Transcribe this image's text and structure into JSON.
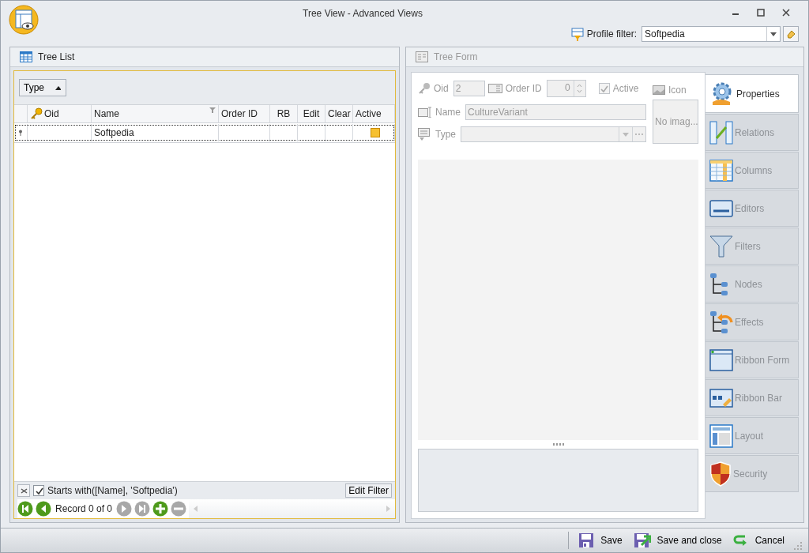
{
  "window": {
    "title": "Tree View - Advanced Views"
  },
  "profile_filter": {
    "label": "Profile filter:",
    "value": "Softpedia"
  },
  "tree_list": {
    "title": "Tree List",
    "group_button": "Type",
    "columns": [
      {
        "label": "Oid"
      },
      {
        "label": "Name"
      },
      {
        "label": "Order ID"
      },
      {
        "label": "RB"
      },
      {
        "label": "Edit"
      },
      {
        "label": "Clear"
      },
      {
        "label": "Active"
      }
    ],
    "rows": [
      {
        "oid": "",
        "name": "Softpedia",
        "order_id": "",
        "active": true
      }
    ],
    "filter": {
      "checked": true,
      "text": "Starts with([Name], 'Softpedia')",
      "edit_button": "Edit Filter"
    },
    "navigator": {
      "record": "Record 0 of 0",
      "buttons": [
        {
          "kind": "first",
          "disabled": false
        },
        {
          "kind": "prev",
          "disabled": false
        },
        {
          "kind": "next",
          "disabled": true
        },
        {
          "kind": "last",
          "disabled": true
        },
        {
          "kind": "add",
          "disabled": false
        },
        {
          "kind": "remove",
          "disabled": true
        }
      ]
    }
  },
  "tree_form": {
    "title": "Tree Form",
    "disabled": true,
    "oid": {
      "label": "Oid",
      "value": "2"
    },
    "order_id": {
      "label": "Order ID",
      "value": "0"
    },
    "active": {
      "label": "Active",
      "checked": true
    },
    "icon": {
      "label": "Icon",
      "image_text": "No imag..."
    },
    "name": {
      "label": "Name",
      "value": "CultureVariant"
    },
    "type": {
      "label": "Type"
    },
    "tabs": [
      {
        "label": "Properties",
        "selected": true
      },
      {
        "label": "Relations",
        "selected": false
      },
      {
        "label": "Columns",
        "selected": false
      },
      {
        "label": "Editors",
        "selected": false
      },
      {
        "label": "Filters",
        "selected": false
      },
      {
        "label": "Nodes",
        "selected": false
      },
      {
        "label": "Effects",
        "selected": false
      },
      {
        "label": "Ribbon Form",
        "selected": false
      },
      {
        "label": "Ribbon Bar",
        "selected": false
      },
      {
        "label": "Layout",
        "selected": false
      },
      {
        "label": "Security",
        "selected": false
      }
    ]
  },
  "footer": {
    "buttons": [
      {
        "kind": "save",
        "label": "Save"
      },
      {
        "kind": "save_close",
        "label": "Save and close"
      },
      {
        "kind": "cancel",
        "label": "Cancel"
      }
    ]
  }
}
